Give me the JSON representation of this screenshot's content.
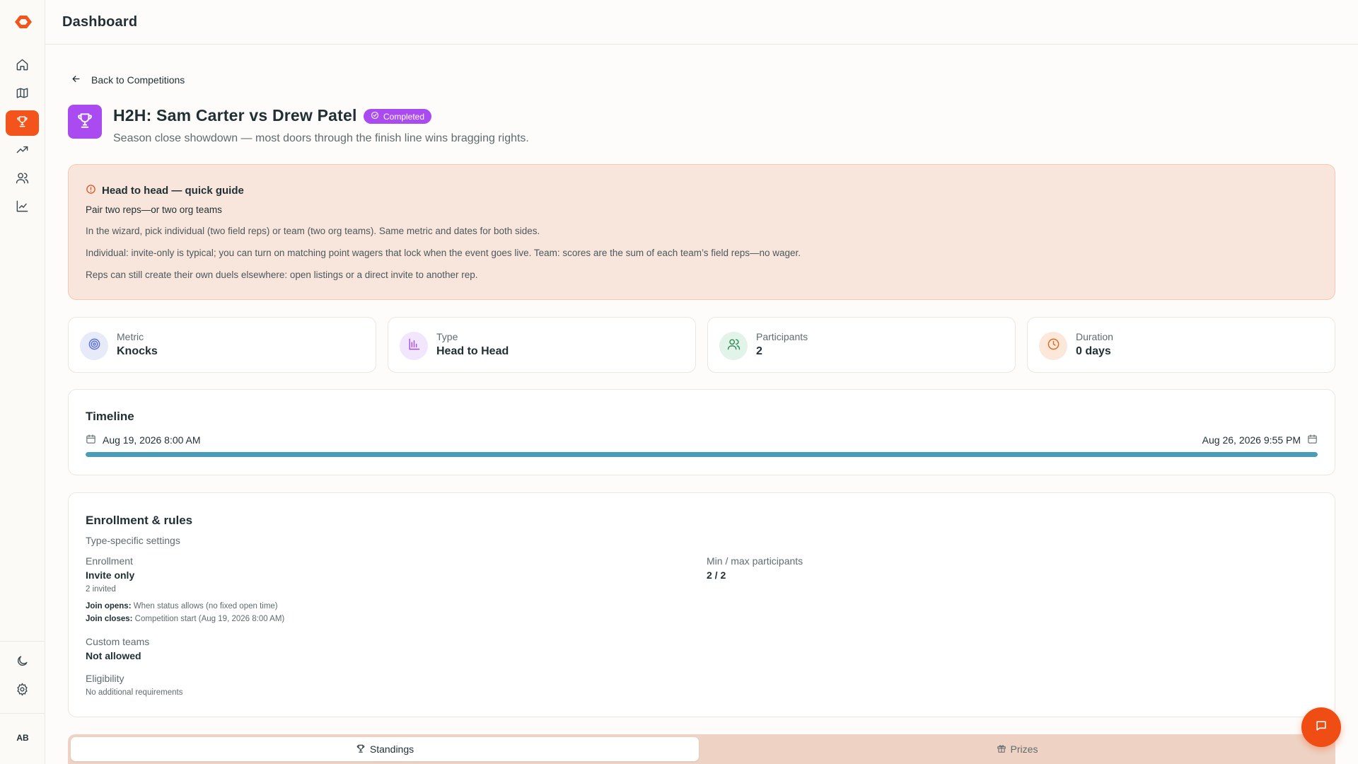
{
  "header": {
    "title": "Dashboard"
  },
  "sidebar": {
    "items": [
      {
        "icon": "home-icon"
      },
      {
        "icon": "map-icon"
      },
      {
        "icon": "trophy-icon",
        "active": true
      },
      {
        "icon": "trending-up-icon"
      },
      {
        "icon": "users-icon"
      },
      {
        "icon": "line-chart-icon"
      }
    ],
    "bottom": [
      {
        "icon": "moon-icon"
      },
      {
        "icon": "gear-icon"
      }
    ],
    "avatar": "AB"
  },
  "back_link": "Back to Competitions",
  "competition": {
    "title": "H2H: Sam Carter vs Drew Patel",
    "status": "Completed",
    "subtitle": "Season close showdown — most doors through the finish line wins bragging rights."
  },
  "guide": {
    "title": "Head to head — quick guide",
    "subtitle": "Pair two reps—or two org teams",
    "lines": [
      "In the wizard, pick individual (two field reps) or team (two org teams). Same metric and dates for both sides.",
      "Individual: invite-only is typical; you can turn on matching point wagers that lock when the event goes live. Team: scores are the sum of each team’s field reps—no wager.",
      "Reps can still create their own duels elsewhere: open listings or a direct invite to another rep."
    ]
  },
  "stats": [
    {
      "label": "Metric",
      "value": "Knocks",
      "icon": "target-icon",
      "color": "#5a6ee0"
    },
    {
      "label": "Type",
      "value": "Head to Head",
      "icon": "bar-chart-icon",
      "color": "#a94bf0"
    },
    {
      "label": "Participants",
      "value": "2",
      "icon": "users-icon",
      "color": "#2f8a5a"
    },
    {
      "label": "Duration",
      "value": "0 days",
      "icon": "clock-icon",
      "color": "#e2661b"
    }
  ],
  "timeline": {
    "title": "Timeline",
    "start": "Aug 19, 2026 8:00 AM",
    "end": "Aug 26, 2026 9:55 PM",
    "progress": 1.0
  },
  "enrollment": {
    "title": "Enrollment & rules",
    "subtitle": "Type-specific settings",
    "enrollment_label": "Enrollment",
    "enrollment_value": "Invite only",
    "invited": "2 invited",
    "join_opens_label": "Join opens:",
    "join_opens_value": "When status allows (no fixed open time)",
    "join_closes_label": "Join closes:",
    "join_closes_value": "Competition start (Aug 19, 2026 8:00 AM)",
    "custom_teams_label": "Custom teams",
    "custom_teams_value": "Not allowed",
    "eligibility_label": "Eligibility",
    "eligibility_value": "No additional requirements",
    "participants_label": "Min / max participants",
    "participants_value": "2 / 2"
  },
  "tabs": [
    {
      "label": "Standings",
      "icon": "trophy-icon",
      "active": true
    },
    {
      "label": "Prizes",
      "icon": "gift-icon",
      "active": false
    }
  ],
  "colors": {
    "accent": "#f2541b",
    "purple": "#a94bf0",
    "timeline": "#4a9db8",
    "guide_bg": "#f8e6dc"
  }
}
